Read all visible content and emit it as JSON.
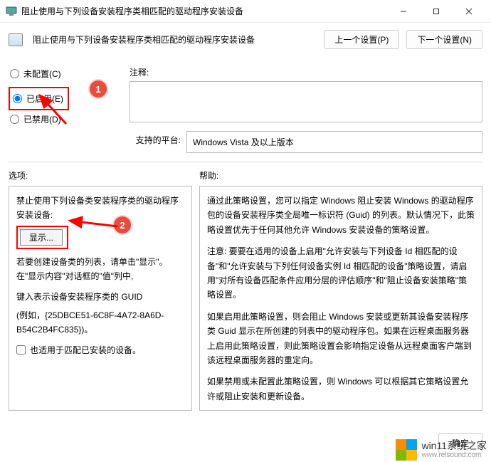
{
  "titlebar": {
    "icon_name": "monitor-icon",
    "title": "阻止使用与下列设备安装程序类相匹配的驱动程序安装设备"
  },
  "toolbar": {
    "title": "阻止使用与下列设备安装程序类相匹配的驱动程序安装设备",
    "prev_label": "上一个设置(P)",
    "next_label": "下一个设置(N)"
  },
  "radios": {
    "not_configured": "未配置(C)",
    "enabled": "已启用(E)",
    "disabled": "已禁用(D)"
  },
  "comment": {
    "label": "注释:"
  },
  "platform": {
    "label": "支持的平台:",
    "value": "Windows Vista 及以上版本"
  },
  "sections": {
    "options": "选项:",
    "help": "帮助:"
  },
  "options_panel": {
    "header": "禁止使用下列设备类安装程序类的驱动程序安装设备:",
    "show_button": "显示...",
    "hint1": "若要创建设备类的列表，请单击\"显示\"。在\"显示内容\"对话框的\"值\"列中,",
    "hint2": "键入表示设备安装程序类的 GUID",
    "hint3": "(例如，{25DBCE51-6C8F-4A72-8A6D-B54C2B4FC835})。",
    "checkbox_label": "也适用于匹配已安装的设备。"
  },
  "help_panel": {
    "p1": "通过此策略设置，您可以指定 Windows 阻止安装 Windows 的驱动程序包的设备安装程序类全局唯一标识符 (Guid) 的列表。默认情况下，此策略设置优先于任何其他允许 Windows 安装设备的策略设置。",
    "p2": "注意: 要要在适用的设备上启用\"允许安装与下列设备 Id 相匹配的设备\"和\"允许安装与下列任何设备实例 Id 相匹配的设备\"策略设置，请启用\"对所有设备匹配条件应用分层的评估顺序\"和\"阻止设备安装策略\"策略设置。",
    "p3": "如果启用此策略设置，则会阻止 Windows 安装或更新其设备安装程序类 Guid 显示在所创建的列表中的驱动程序包。如果在远程桌面服务器上启用此策略设置，则此策略设置会影响指定设备从远程桌面客户端到该远程桌面服务器的重定向。",
    "p4": "如果禁用或未配置此策略设置，则 Windows 可以根据其它策略设置允许或阻止安装和更新设备。"
  },
  "footer": {
    "ok": "确定"
  },
  "callouts": {
    "one": "1",
    "two": "2"
  },
  "watermark": {
    "name": "win11系统之家",
    "url": "www.relsound.com"
  }
}
